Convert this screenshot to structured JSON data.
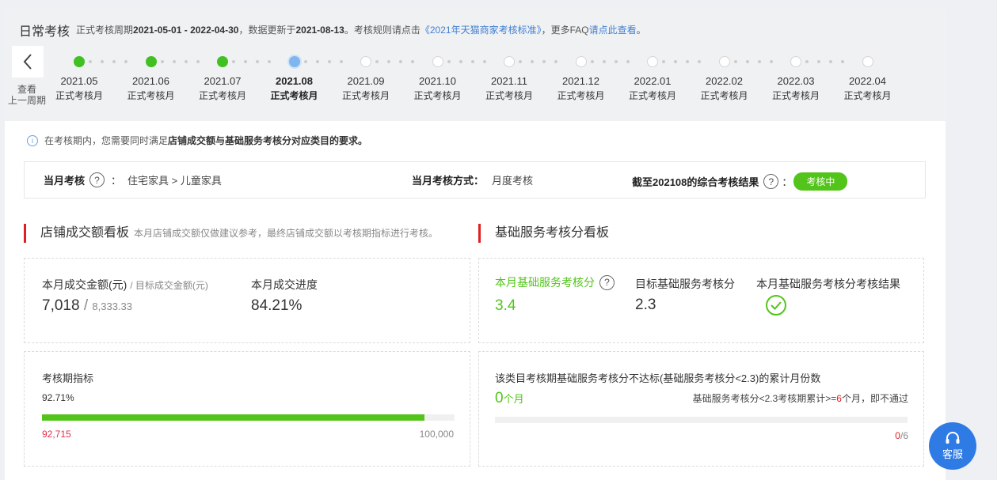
{
  "header": {
    "title": "日常考核",
    "subtitle_prefix": "正式考核周期",
    "period": "2021-05-01 - 2022-04-30",
    "data_update_prefix": "，数据更新于",
    "update_date": "2021-08-13",
    "rule_prefix": "。考核规则请点击",
    "rule_link": "《2021年天猫商家考核标准》",
    "faq_prefix": "，更多FAQ",
    "faq_link": "请点此查看",
    "faq_suffix": "。"
  },
  "timeline": {
    "prev_label_line1": "查看",
    "prev_label_line2": "上一周期",
    "months": [
      {
        "month": "2021.05",
        "status_label": "正式考核月",
        "state": "done"
      },
      {
        "month": "2021.06",
        "status_label": "正式考核月",
        "state": "done"
      },
      {
        "month": "2021.07",
        "status_label": "正式考核月",
        "state": "done"
      },
      {
        "month": "2021.08",
        "status_label": "正式考核月",
        "state": "current"
      },
      {
        "month": "2021.09",
        "status_label": "正式考核月",
        "state": "future"
      },
      {
        "month": "2021.10",
        "status_label": "正式考核月",
        "state": "future"
      },
      {
        "month": "2021.11",
        "status_label": "正式考核月",
        "state": "future"
      },
      {
        "month": "2021.12",
        "status_label": "正式考核月",
        "state": "future"
      },
      {
        "month": "2022.01",
        "status_label": "正式考核月",
        "state": "future"
      },
      {
        "month": "2022.02",
        "status_label": "正式考核月",
        "state": "future"
      },
      {
        "month": "2022.03",
        "status_label": "正式考核月",
        "state": "future"
      },
      {
        "month": "2022.04",
        "status_label": "正式考核月",
        "state": "future"
      }
    ]
  },
  "notice": {
    "prefix": "在考核期内，您需要同时满足",
    "bold": "店铺成交额与基础服务考核分对应类目的要求。"
  },
  "exam": {
    "month_label": "当月考核",
    "category": "住宅家具 > 儿童家具",
    "method_label": "当月考核方式：",
    "method_value": "月度考核",
    "result_label": "截至202108的综合考核结果",
    "result_badge": "考核中",
    "colon": "："
  },
  "sales_board": {
    "title": "店铺成交额看板",
    "note": "本月店铺成交额仅做建议参考，最终店铺成交额以考核期指标进行考核。",
    "amount_label": "本月成交金额(元)",
    "target_label": "/ 目标成交金额(元)",
    "amount_value": "7,018",
    "separator": "/",
    "target_value": "8,333.33",
    "progress_label": "本月成交进度",
    "progress_value": "84.21%",
    "period_label": "考核期指标",
    "period_percent": "92.71%",
    "period_fraction": 0.9271,
    "period_current": "92,715",
    "period_target": "100,000"
  },
  "service_board": {
    "title": "基础服务考核分看板",
    "score_label": "本月基础服务考核分",
    "score_value": "3.4",
    "target_label": "目标基础服务考核分",
    "target_value": "2.3",
    "result_label": "本月基础服务考核分考核结果",
    "result_icon": "check-circle-icon",
    "fail_title": "该类目考核期基础服务考核分不达标(基础服务考核分<2.3)的累计月份数",
    "fail_count": "0",
    "fail_unit": "个月",
    "rule_prefix": "基础服务考核分<2.3考核期累计>=",
    "rule_num": "6",
    "rule_suffix": "个月，即不通过",
    "fail_fraction": 0,
    "counter_current": "0",
    "counter_total": "/6"
  },
  "support": {
    "label": "客服",
    "icon": "headset-icon"
  },
  "colors": {
    "accent_green": "#52c41a",
    "current_blue": "#7fb6ee",
    "link_blue": "#3f7fd1",
    "warning_red": "#e02020"
  }
}
